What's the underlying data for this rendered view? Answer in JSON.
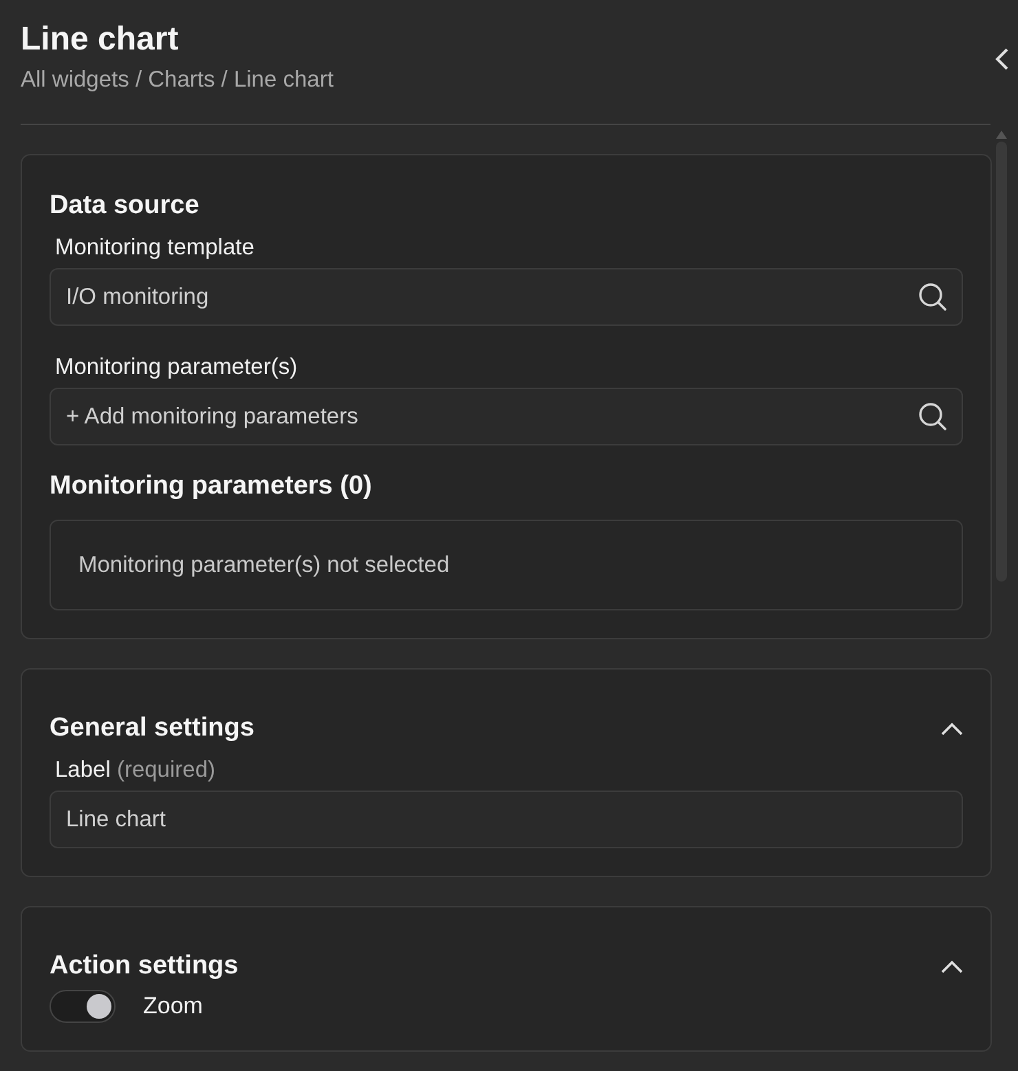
{
  "header": {
    "title": "Line chart",
    "breadcrumb": "All widgets / Charts / Line chart"
  },
  "sections": [
    {
      "title": "Data source",
      "items": [
        {
          "kind": "field",
          "label": "Monitoring template",
          "value": "I/O monitoring",
          "search": true
        },
        {
          "kind": "field",
          "label": "Monitoring parameter(s)",
          "placeholder": "+ Add monitoring parameters",
          "search": true
        },
        {
          "kind": "subheading",
          "text": "Monitoring parameters (0)"
        },
        {
          "kind": "empty",
          "text": "Monitoring parameter(s) not selected"
        }
      ]
    },
    {
      "title": "General settings",
      "expanded": true,
      "items": [
        {
          "kind": "field",
          "label": "Label",
          "hint": "(required)",
          "value": "Line chart",
          "search": false
        }
      ]
    },
    {
      "title": "Action settings",
      "expanded": true,
      "items": [
        {
          "kind": "toggle",
          "label": "Zoom",
          "on": true
        }
      ]
    }
  ]
}
